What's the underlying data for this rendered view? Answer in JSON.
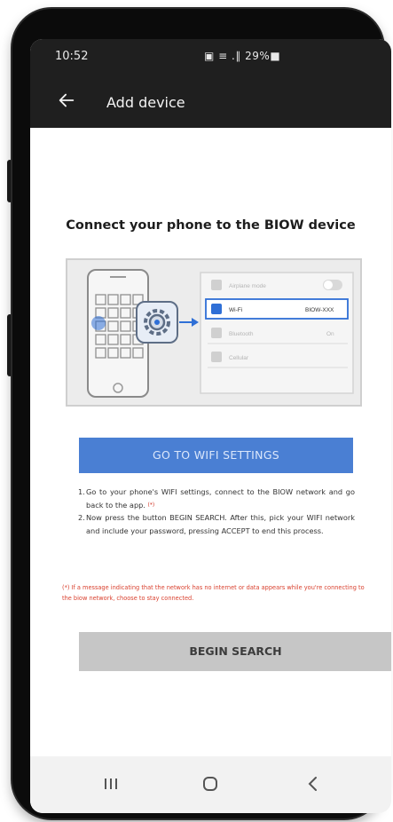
{
  "status_bar": {
    "time": "10:52",
    "icons": "▣ ≡ .∥ 29%■"
  },
  "app_bar": {
    "title": "Add device"
  },
  "heading": "Connect your phone to the BIOW device",
  "illustration": {
    "rows": [
      {
        "label": "Airplane mode",
        "value": "",
        "icon": "airplane-icon",
        "toggle": true
      },
      {
        "label": "Wi-Fi",
        "value": "BIOW-XXX",
        "icon": "wifi-icon",
        "highlight": true
      },
      {
        "label": "Bluetooth",
        "value": "On",
        "icon": "bluetooth-icon"
      },
      {
        "label": "Cellular",
        "value": "",
        "icon": "cellular-icon"
      }
    ]
  },
  "wifi_button": "GO TO WIFI SETTINGS",
  "steps": [
    {
      "num": "1.",
      "text": "Go to your phone's WIFI settings, connect to the BIOW network and go back to the app.",
      "mark": "(*)"
    },
    {
      "num": "2.",
      "text": "Now press the button BEGIN SEARCH. After this, pick your WIFI network and include your password, pressing ACCEPT to end this process.",
      "mark": ""
    }
  ],
  "note": "(*) If a message indicating that the network has no internet or data appears while you're connecting to the biow network, choose to stay connected.",
  "search_button": "BEGIN SEARCH",
  "nav_bar": {
    "recents_icon": "recents-icon",
    "home_icon": "home-icon",
    "back_icon": "nav-back-icon"
  },
  "colors": {
    "app_bar": "#1f1f1f",
    "primary_button": "#4a7fd3",
    "secondary_button": "#c6c6c6",
    "note_text": "#d9412f",
    "wifi_highlight": "#2f6fd6"
  }
}
